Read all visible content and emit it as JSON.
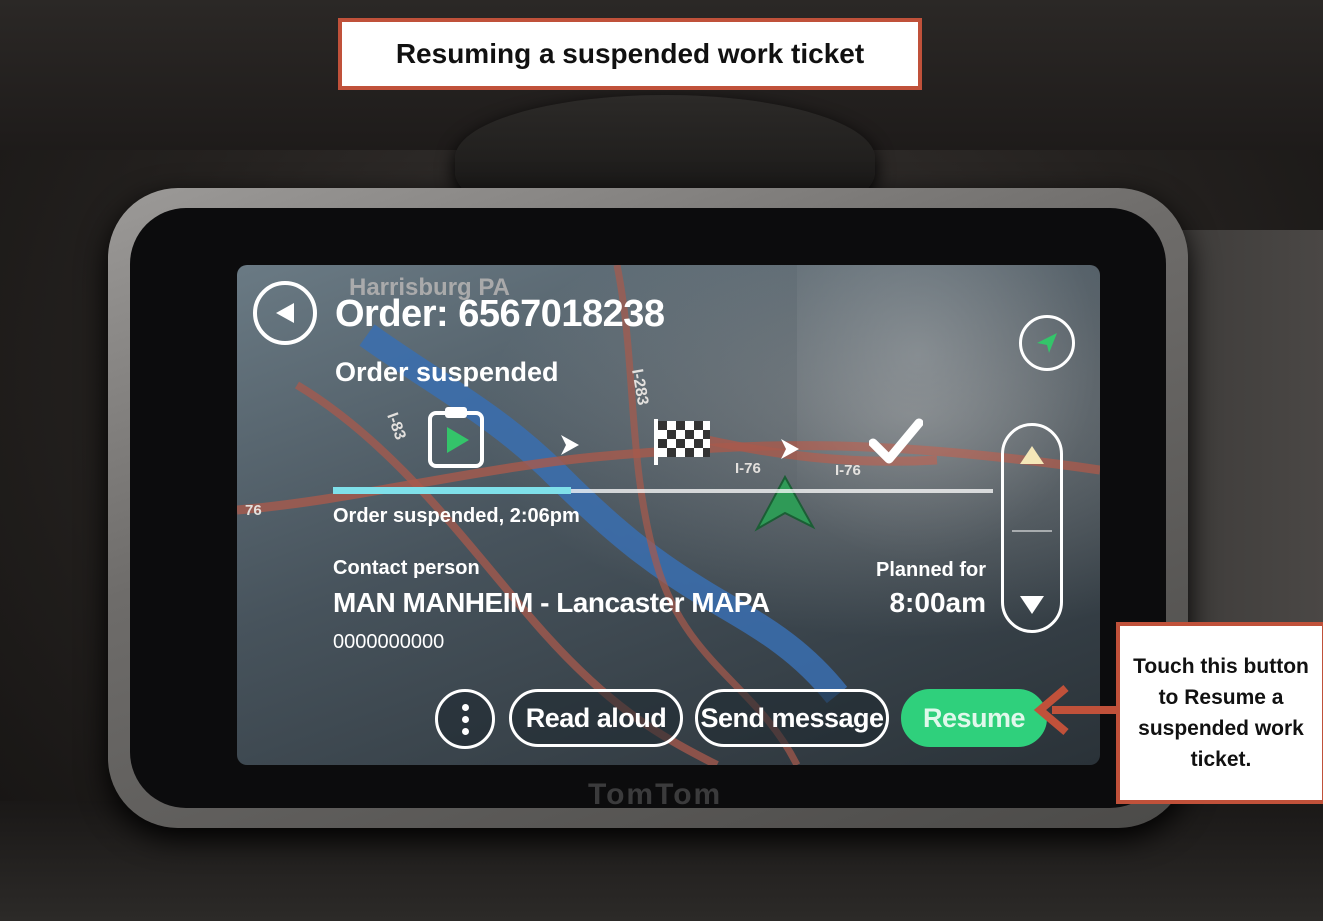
{
  "callouts": {
    "title": "Resuming a suspended work ticket",
    "instruction": "Touch this button to Resume a suspended work ticket."
  },
  "map": {
    "city_label": "Harrisburg PA",
    "road_labels": [
      "I-83",
      "I-283",
      "I-76",
      "I-76",
      "76"
    ]
  },
  "order": {
    "title": "Order: 6567018238",
    "status": "Order suspended",
    "status_time": "Order suspended, 2:06pm",
    "progress_fraction": 0.36,
    "steps": [
      "clipboard-play-icon",
      "checkered-flag-icon",
      "checkmark-icon"
    ]
  },
  "contact": {
    "label": "Contact person",
    "name": "MAN MANHEIM  - Lancaster MAPA",
    "phone": "0000000000"
  },
  "schedule": {
    "label": "Planned for",
    "time": "8:00am"
  },
  "actions": {
    "read_aloud": "Read aloud",
    "send_message": "Send message",
    "resume": "Resume"
  },
  "colors": {
    "resume_green": "#2fd07c",
    "progress_cyan": "#7fe0ea",
    "callout_border": "#c0513a",
    "route_red": "#a85a4c",
    "river_blue": "#3a6fb0"
  },
  "device": {
    "brand": "TomTom"
  }
}
